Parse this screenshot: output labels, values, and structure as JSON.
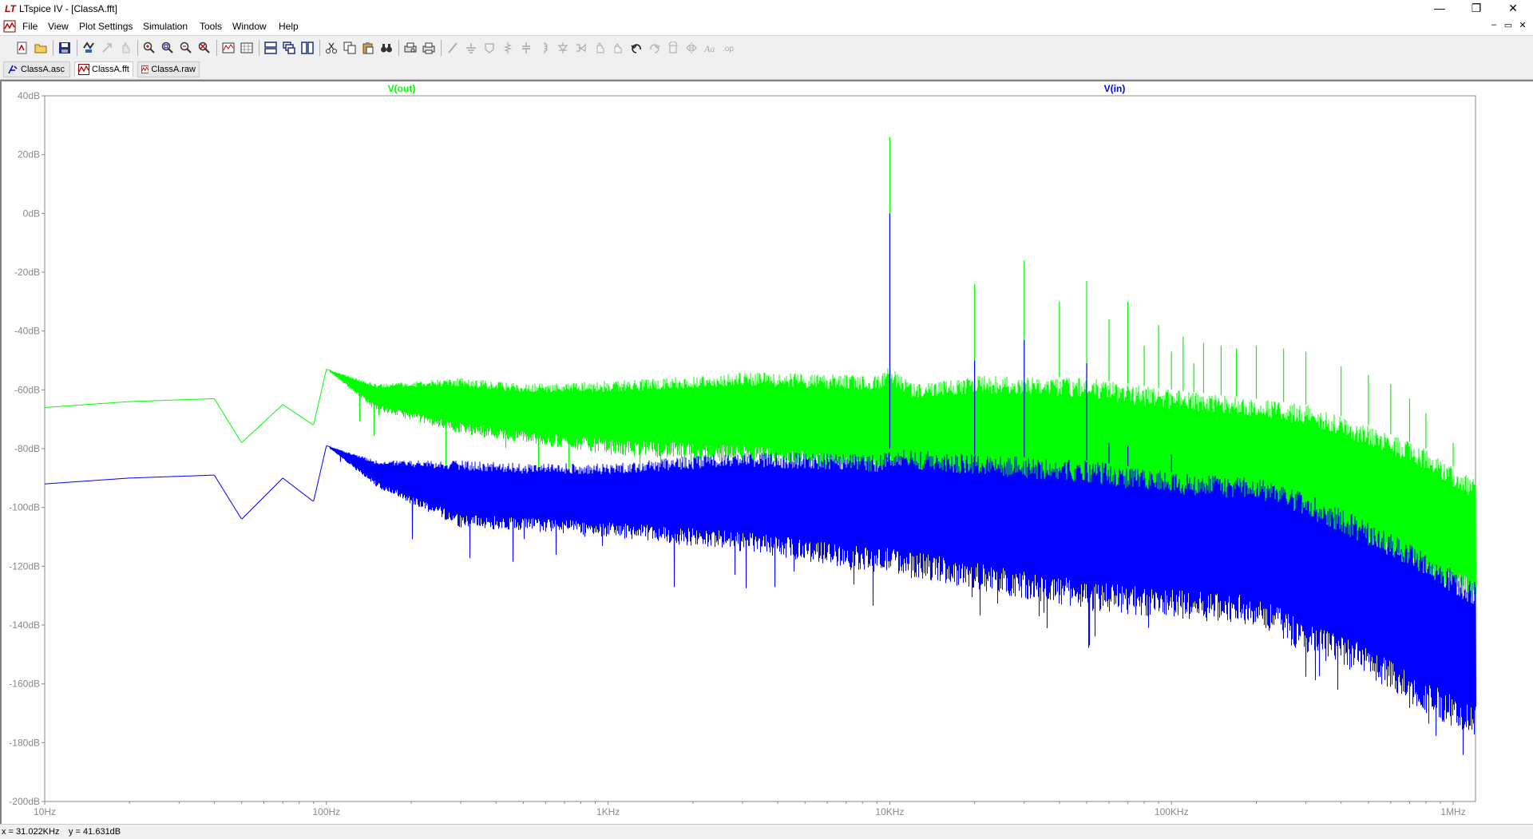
{
  "window": {
    "title": "LTspice IV - [ClassA.fft]",
    "minimize_glyph": "—",
    "maximize_glyph": "❐",
    "close_glyph": "✕"
  },
  "menu": {
    "items": [
      {
        "label": "File"
      },
      {
        "label": "View"
      },
      {
        "label": "Plot Settings"
      },
      {
        "label": "Simulation"
      },
      {
        "label": "Tools"
      },
      {
        "label": "Window"
      },
      {
        "label": "Help"
      }
    ],
    "mdi": {
      "minimize": "–",
      "restore": "▭",
      "close": "✕"
    }
  },
  "toolbar": {
    "groups": [
      [
        "new-schematic-icon",
        "open-icon"
      ],
      [
        "save-icon"
      ],
      [
        "control-panel-icon",
        "run-icon",
        "halt-icon"
      ],
      [
        "zoom-in-icon",
        "zoom-area-icon",
        "zoom-out-icon",
        "zoom-cancel-icon"
      ],
      [
        "autorange-icon",
        "grid-icon"
      ],
      [
        "tile-horizontal-icon",
        "cascade-icon",
        "tile-vertical-icon"
      ],
      [
        "cut-icon",
        "copy-icon",
        "paste-icon",
        "find-icon"
      ],
      [
        "print-preview-icon",
        "print-icon"
      ],
      [
        "draw-wire-icon",
        "ground-icon",
        "label-icon",
        "resistor-icon",
        "capacitor-icon",
        "inductor-icon",
        "diode-icon",
        "component-icon",
        "move-icon",
        "drag-icon",
        "undo-icon",
        "redo-icon",
        "rotate-icon",
        "mirror-icon",
        "text-icon",
        "spice-directive-icon"
      ]
    ]
  },
  "tabs": [
    {
      "label": "ClassA.asc",
      "icon": "schematic-icon"
    },
    {
      "label": "ClassA.fft",
      "icon": "waveform-icon",
      "active": true
    },
    {
      "label": "ClassA.raw",
      "icon": "waveform-icon"
    }
  ],
  "status": {
    "x": "x = 31.022KHz",
    "y": "y = 41.631dB"
  },
  "chart_data": {
    "type": "line",
    "x_scale": "log",
    "xlim": [
      10,
      1200000
    ],
    "ylim": [
      -200,
      40
    ],
    "grid": false,
    "xticks": [
      {
        "v": 10,
        "label": "10Hz"
      },
      {
        "v": 100,
        "label": "100Hz"
      },
      {
        "v": 1000,
        "label": "1KHz"
      },
      {
        "v": 10000,
        "label": "10KHz"
      },
      {
        "v": 100000,
        "label": "100KHz"
      },
      {
        "v": 1000000,
        "label": "1MHz"
      }
    ],
    "yticks": [
      {
        "v": 40,
        "label": "40dB"
      },
      {
        "v": 20,
        "label": "20dB"
      },
      {
        "v": 0,
        "label": "0dB"
      },
      {
        "v": -20,
        "label": "-20dB"
      },
      {
        "v": -40,
        "label": "-40dB"
      },
      {
        "v": -60,
        "label": "-60dB"
      },
      {
        "v": -80,
        "label": "-80dB"
      },
      {
        "v": -100,
        "label": "-100dB"
      },
      {
        "v": -120,
        "label": "-120dB"
      },
      {
        "v": -140,
        "label": "-140dB"
      },
      {
        "v": -160,
        "label": "-160dB"
      },
      {
        "v": -180,
        "label": "-180dB"
      },
      {
        "v": -200,
        "label": "-200dB"
      }
    ],
    "series": [
      {
        "name": "V(out)",
        "color": "#00ff00",
        "envelope": [
          [
            10,
            -66,
            -66
          ],
          [
            20,
            -64,
            -64
          ],
          [
            40,
            -63,
            -63
          ],
          [
            50,
            -78,
            -78
          ],
          [
            70,
            -65,
            -65
          ],
          [
            90,
            -72,
            -72
          ],
          [
            100,
            -53,
            -53
          ],
          [
            150,
            -58,
            -67
          ],
          [
            300,
            -56,
            -75
          ],
          [
            500,
            -58,
            -78
          ],
          [
            1000,
            -57,
            -82
          ],
          [
            3000,
            -54,
            -85
          ],
          [
            9000,
            -55,
            -90
          ],
          [
            10000,
            -52,
            -90
          ],
          [
            12000,
            -58,
            -92
          ],
          [
            20000,
            -55,
            -95
          ],
          [
            50000,
            -56,
            -100
          ],
          [
            100000,
            -60,
            -105
          ],
          [
            200000,
            -63,
            -103
          ],
          [
            300000,
            -65,
            -110
          ],
          [
            500000,
            -72,
            -118
          ],
          [
            800000,
            -80,
            -128
          ],
          [
            1150000,
            -90,
            -132
          ]
        ],
        "peaks": [
          [
            10000,
            26
          ],
          [
            20000,
            -24
          ],
          [
            30000,
            -16
          ],
          [
            40000,
            -30
          ],
          [
            50000,
            -23
          ],
          [
            60000,
            -36
          ],
          [
            70000,
            -30
          ],
          [
            80000,
            -45
          ],
          [
            90000,
            -38
          ],
          [
            100000,
            -47
          ],
          [
            110000,
            -42
          ],
          [
            120000,
            -51
          ],
          [
            130000,
            -44
          ],
          [
            150000,
            -45
          ],
          [
            170000,
            -46
          ],
          [
            200000,
            -45
          ],
          [
            250000,
            -46
          ],
          [
            300000,
            -47
          ],
          [
            400000,
            -52
          ],
          [
            500000,
            -55
          ],
          [
            600000,
            -58
          ],
          [
            700000,
            -63
          ],
          [
            800000,
            -68
          ],
          [
            1000000,
            -78
          ]
        ]
      },
      {
        "name": "V(in)",
        "color": "#0000ff",
        "envelope": [
          [
            10,
            -92,
            -92
          ],
          [
            20,
            -90,
            -90
          ],
          [
            40,
            -89,
            -89
          ],
          [
            50,
            -104,
            -104
          ],
          [
            70,
            -90,
            -90
          ],
          [
            90,
            -98,
            -98
          ],
          [
            100,
            -79,
            -79
          ],
          [
            150,
            -84,
            -93
          ],
          [
            300,
            -84,
            -107
          ],
          [
            500,
            -85,
            -108
          ],
          [
            1000,
            -85,
            -110
          ],
          [
            3000,
            -81,
            -115
          ],
          [
            9000,
            -82,
            -122
          ],
          [
            10000,
            -80,
            -122
          ],
          [
            20000,
            -82,
            -128
          ],
          [
            50000,
            -84,
            -135
          ],
          [
            100000,
            -88,
            -138
          ],
          [
            200000,
            -90,
            -140
          ],
          [
            300000,
            -95,
            -150
          ],
          [
            500000,
            -105,
            -158
          ],
          [
            800000,
            -115,
            -170
          ],
          [
            1150000,
            -125,
            -178
          ]
        ],
        "peaks": [
          [
            10000,
            0
          ],
          [
            20000,
            -50
          ],
          [
            30000,
            -43
          ],
          [
            50000,
            -51
          ],
          [
            60000,
            -78
          ],
          [
            70000,
            -79
          ],
          [
            100000,
            -82
          ]
        ]
      }
    ]
  }
}
